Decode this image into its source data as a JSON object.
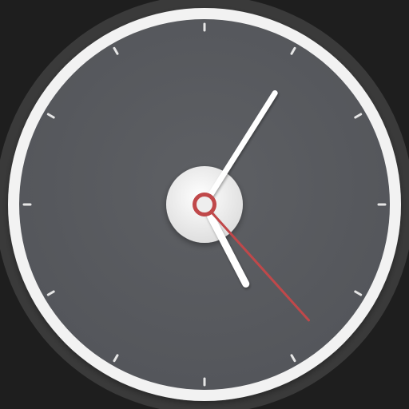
{
  "clock": {
    "time": {
      "hours": 5,
      "minutes": 5,
      "seconds": 23
    },
    "tick_marks": 12,
    "colors": {
      "background": "#1e1e1e",
      "bezel": "#3a3a3a",
      "ring": "#f2f2f2",
      "dial": "#5a5c60",
      "tick": "#e6e6e6",
      "hand": "#ffffff",
      "second_hand": "#c0484a",
      "hub": "#eeeeee"
    },
    "icons": {
      "dial": "clock-dial",
      "hub": "hub-cap"
    }
  }
}
